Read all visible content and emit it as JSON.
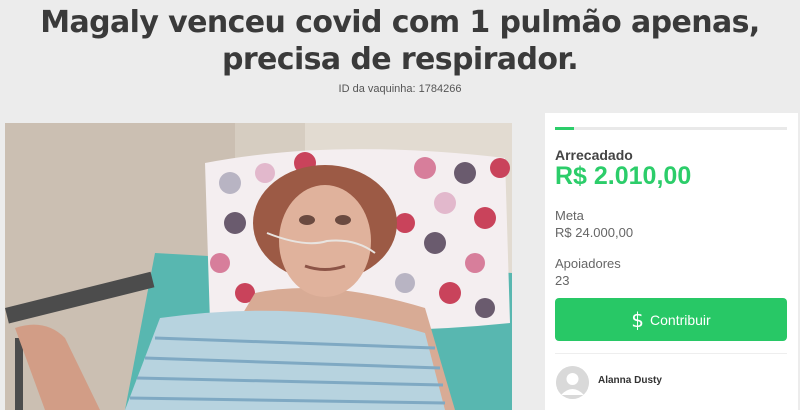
{
  "campaign": {
    "title": "Magaly venceu covid com 1 pulmão apenas, precisa de respirador.",
    "id_text": "ID da vaquinha: 1784266"
  },
  "photo": {
    "icon": "patient-photo"
  },
  "stats": {
    "raised_label": "Arrecadado",
    "raised_value": "R$ 2.010,00",
    "goal_label": "Meta",
    "goal_value": "R$ 24.000,00",
    "supporters_label": "Apoiadores",
    "supporters_value": "23",
    "progress_fraction": 0.084
  },
  "actions": {
    "contribute_symbol": "$",
    "contribute_label": "Contribuir"
  },
  "supporters": [
    {
      "name": "Alanna Dusty",
      "avatar_icon": "user-avatar"
    }
  ],
  "colors": {
    "accent": "#2ccd6a",
    "button": "#28c866",
    "background": "#ececec"
  }
}
